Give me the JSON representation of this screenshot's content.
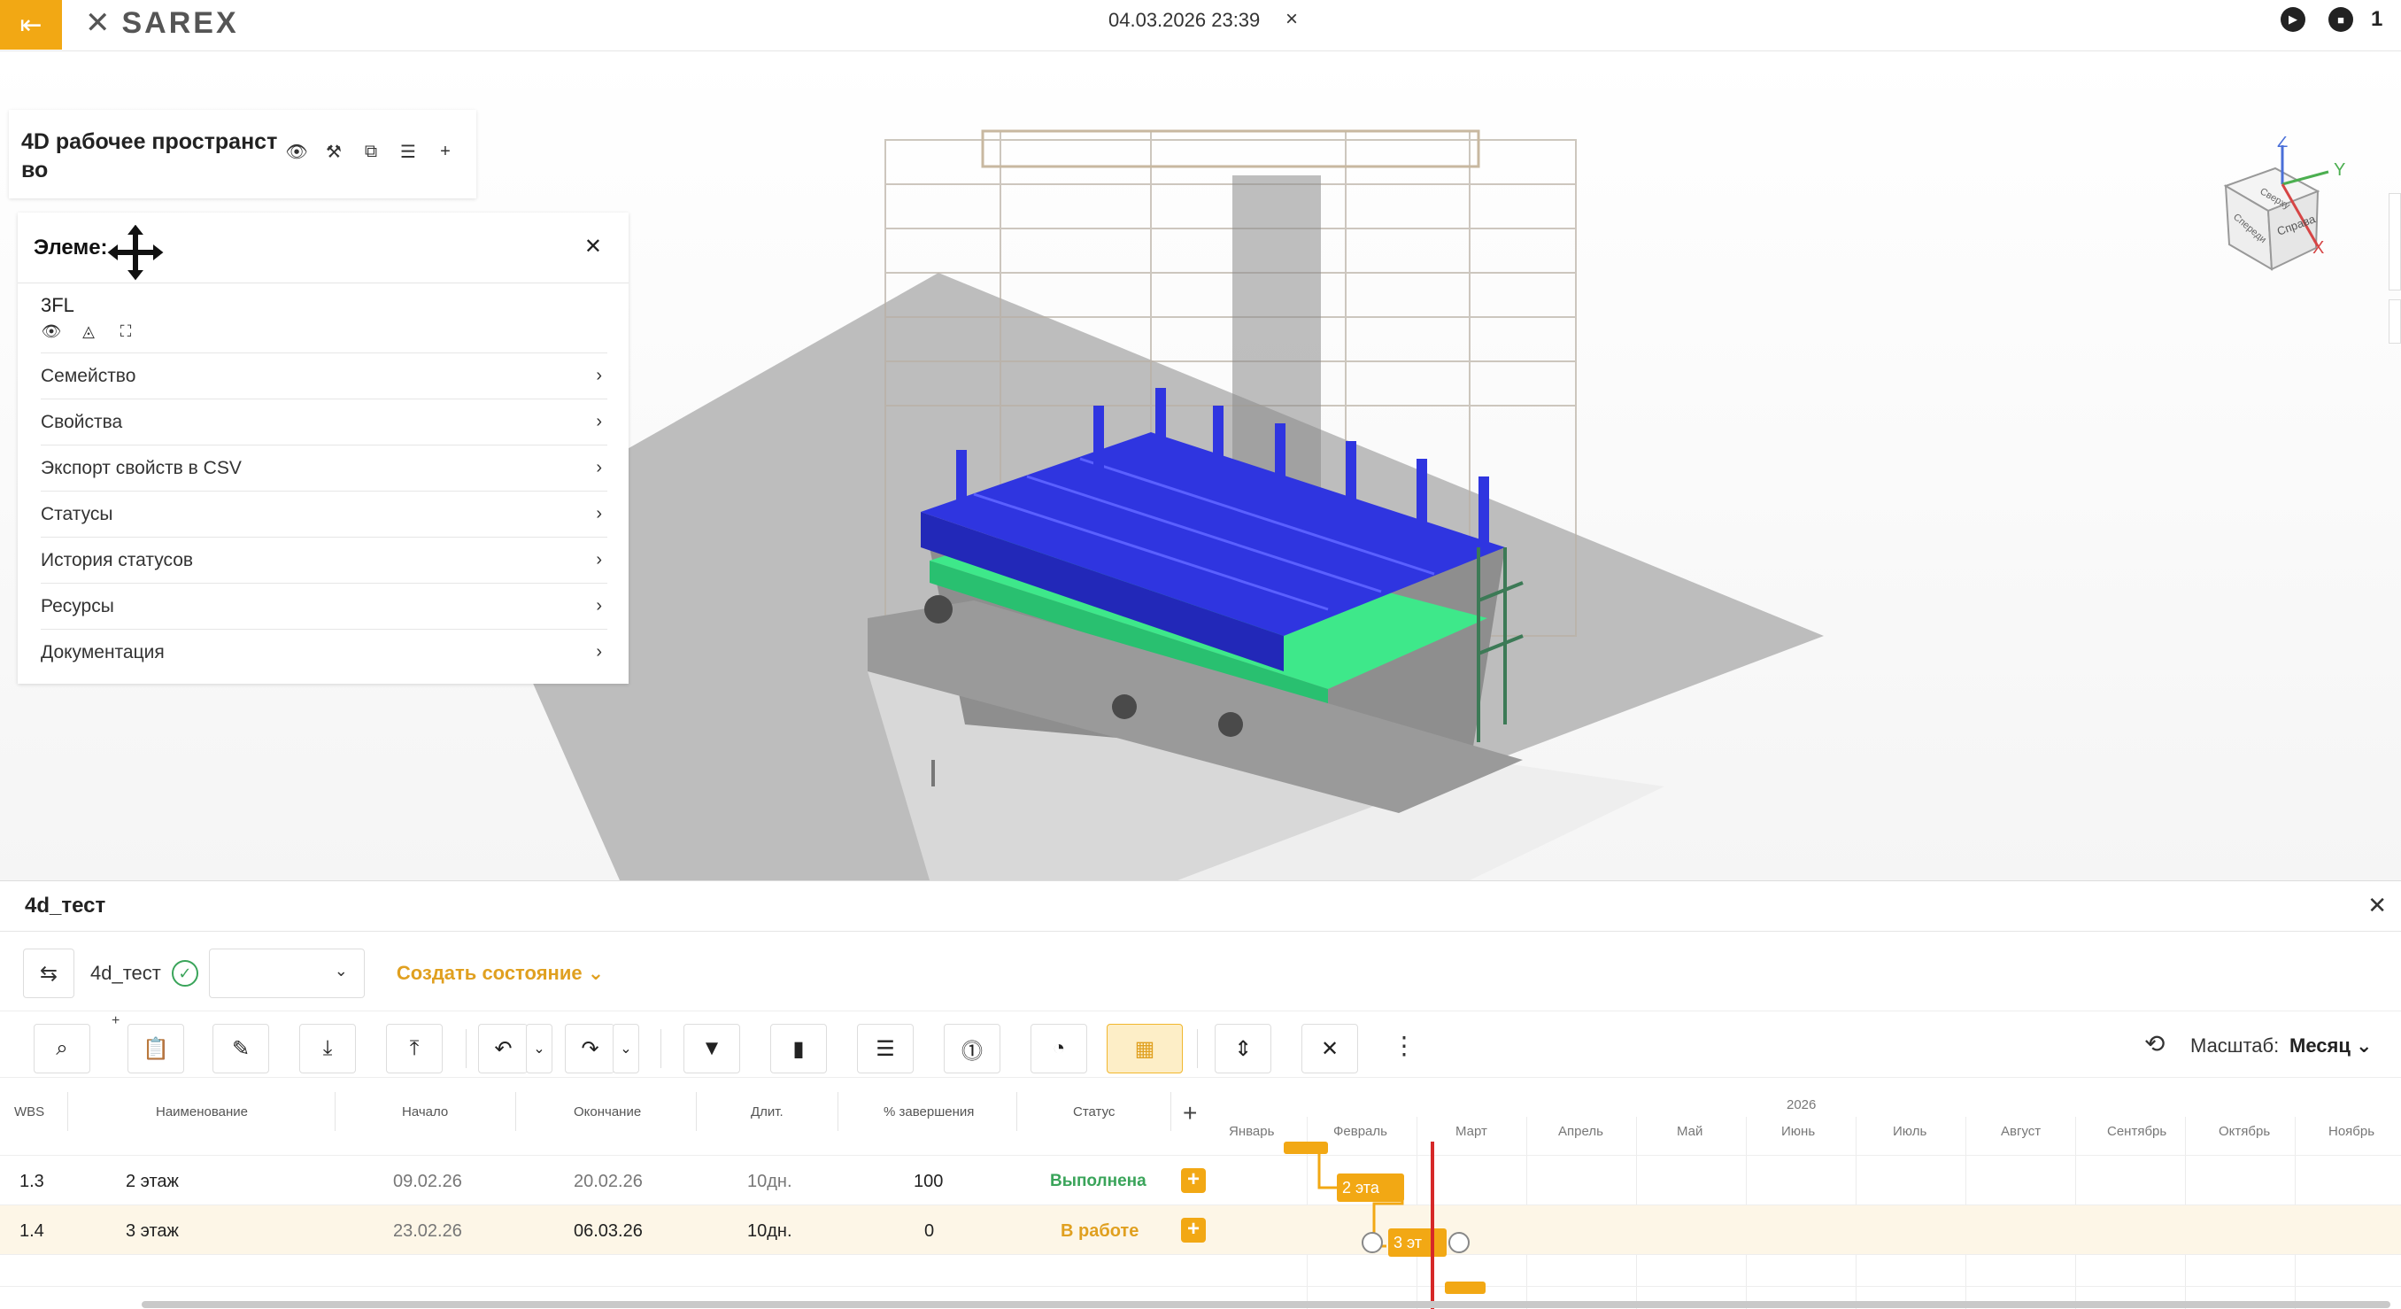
{
  "topbar": {
    "logo_text": "SAREX",
    "datetime": "04.03.2026 23:39",
    "close_glyph": "×",
    "count": "1"
  },
  "workspace": {
    "title": "4D рабочее пространст во"
  },
  "elements_panel": {
    "title": "Элеме:",
    "element_name": "3FL",
    "items": [
      {
        "label": "Семейство"
      },
      {
        "label": "Свойства"
      },
      {
        "label": "Экспорт свойств в CSV"
      },
      {
        "label": "Статусы"
      },
      {
        "label": "История статусов"
      },
      {
        "label": "Ресурсы"
      },
      {
        "label": "Документация"
      }
    ]
  },
  "view_cube": {
    "axis_z": "Z",
    "axis_y": "Y",
    "axis_x": "X",
    "face_top": "Сверху",
    "face_front": "Спереди",
    "face_right": "Справа"
  },
  "bottom_panel": {
    "title": "4d_тест",
    "state_name": "4d_тест",
    "create_state_label": "Создать состояние",
    "scale_label": "Масштаб:",
    "scale_value": "Месяц"
  },
  "table": {
    "columns": {
      "wbs": "WBS",
      "name": "Наименование",
      "start": "Начало",
      "end": "Окончание",
      "duration": "Длит.",
      "percent": "% завершения",
      "status": "Статус"
    },
    "rows": [
      {
        "wbs": "1.3",
        "name": "2 этаж",
        "start": "09.02.26",
        "end": "20.02.26",
        "duration": "10дн.",
        "percent": "100",
        "status": "Выполнена"
      },
      {
        "wbs": "1.4",
        "name": "3 этаж",
        "start": "23.02.26",
        "end": "06.03.26",
        "duration": "10дн.",
        "percent": "0",
        "status": "В работе"
      }
    ]
  },
  "timeline": {
    "year": "2026",
    "months": [
      "Январь",
      "Февраль",
      "Март",
      "Апрель",
      "Май",
      "Июнь",
      "Июль",
      "Август",
      "Сентябрь",
      "Октябрь",
      "Ноябрь"
    ],
    "bars": [
      {
        "label": "2 эта"
      },
      {
        "label": "3 эт"
      }
    ]
  },
  "colors": {
    "accent": "#f2a814",
    "done": "#3aa45a",
    "today_line": "#d62828",
    "model_blue": "#2f35e0",
    "model_green": "#3ee88a"
  }
}
